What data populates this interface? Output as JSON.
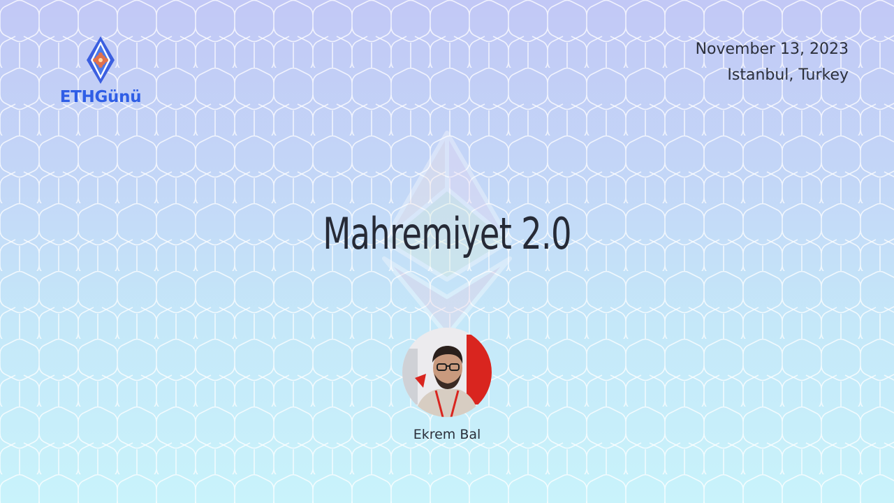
{
  "brand": {
    "name": "ETHGünü",
    "color": "#2f5ee6",
    "logo_icon": "diamond-ornament-icon"
  },
  "event": {
    "date": "November 13, 2023",
    "location": "Istanbul, Turkey"
  },
  "talk": {
    "title": "Mahremiyet 2.0"
  },
  "speaker": {
    "name": "Ekrem Bal",
    "avatar_icon": "speaker-photo"
  },
  "background": {
    "top_color": "#c2c8f6",
    "bottom_color": "#c9f3fb",
    "pattern": "hexagonal-lattice",
    "watermark_icon": "ethereum-logo-icon"
  }
}
